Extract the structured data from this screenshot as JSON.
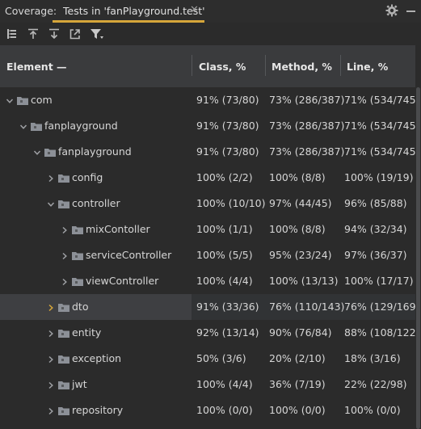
{
  "topbar": {
    "coverage_label": "Coverage:",
    "tab_label": "Tests in 'fanPlayground.test'",
    "close_glyph": "✕",
    "accent_color": "#d6a63a"
  },
  "toolbar": {
    "icons": [
      "flatten-packages-icon",
      "import-coverage-icon",
      "export-coverage-icon",
      "generate-report-icon",
      "filter-icon"
    ]
  },
  "table": {
    "columns": [
      "Element",
      "Class, %",
      "Method, %",
      "Line, %"
    ],
    "sort_indicator": "—",
    "rows": [
      {
        "name": "com",
        "level": 0,
        "expanded": true,
        "class": "91% (73/80)",
        "method": "73% (286/387)",
        "line": "71% (534/745)"
      },
      {
        "name": "fanplayground",
        "level": 1,
        "expanded": true,
        "class": "91% (73/80)",
        "method": "73% (286/387)",
        "line": "71% (534/745)"
      },
      {
        "name": "fanplayground",
        "level": 2,
        "expanded": true,
        "class": "91% (73/80)",
        "method": "73% (286/387)",
        "line": "71% (534/745)"
      },
      {
        "name": "config",
        "level": 3,
        "expanded": false,
        "class": "100% (2/2)",
        "method": "100% (8/8)",
        "line": "100% (19/19)"
      },
      {
        "name": "controller",
        "level": 3,
        "expanded": true,
        "class": "100% (10/10)",
        "method": "97% (44/45)",
        "line": "96% (85/88)"
      },
      {
        "name": "mixContoller",
        "level": 4,
        "expanded": false,
        "class": "100% (1/1)",
        "method": "100% (8/8)",
        "line": "94% (32/34)"
      },
      {
        "name": "serviceController",
        "level": 4,
        "expanded": false,
        "class": "100% (5/5)",
        "method": "95% (23/24)",
        "line": "97% (36/37)"
      },
      {
        "name": "viewController",
        "level": 4,
        "expanded": false,
        "class": "100% (4/4)",
        "method": "100% (13/13)",
        "line": "100% (17/17)"
      },
      {
        "name": "dto",
        "level": 3,
        "expanded": false,
        "selected": true,
        "class": "91% (33/36)",
        "method": "76% (110/143)",
        "line": "76% (129/169)"
      },
      {
        "name": "entity",
        "level": 3,
        "expanded": false,
        "class": "92% (13/14)",
        "method": "90% (76/84)",
        "line": "88% (108/122)"
      },
      {
        "name": "exception",
        "level": 3,
        "expanded": false,
        "class": "50% (3/6)",
        "method": "20% (2/10)",
        "line": "18% (3/16)"
      },
      {
        "name": "jwt",
        "level": 3,
        "expanded": false,
        "class": "100% (4/4)",
        "method": "36% (7/19)",
        "line": "22% (22/98)"
      },
      {
        "name": "repository",
        "level": 3,
        "expanded": false,
        "class": "100% (0/0)",
        "method": "100% (0/0)",
        "line": "100% (0/0)"
      }
    ]
  },
  "colors": {
    "background": "#2b2b2b",
    "header": "#3a3b3d",
    "selected_row": "#3e3f42",
    "chevron": "#9ea0a4",
    "chevron_selected": "#d6a63a",
    "folder": "#8c9097"
  }
}
